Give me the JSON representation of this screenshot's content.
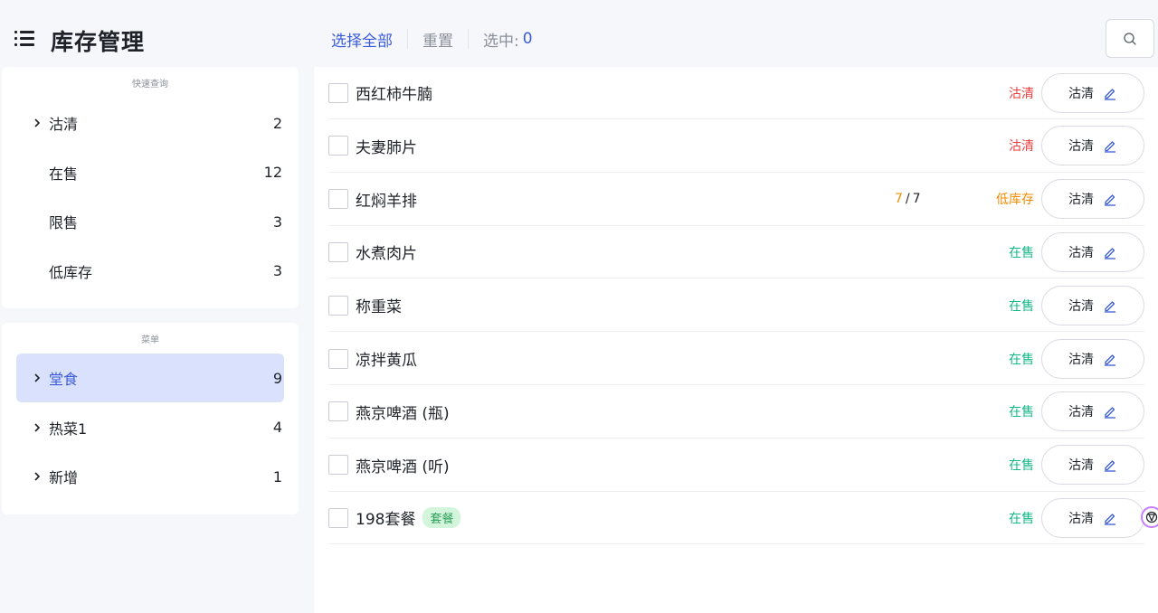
{
  "header": {
    "title": "库存管理",
    "select_all": "选择全部",
    "reset": "重置",
    "selected_label": "选中:",
    "selected_count": "0"
  },
  "sidebar": {
    "quick_title": "快速查询",
    "quick_items": [
      {
        "label": "沽清",
        "count": "2",
        "expandable": true
      },
      {
        "label": "在售",
        "count": "12",
        "expandable": false
      },
      {
        "label": "限售",
        "count": "3",
        "expandable": false
      },
      {
        "label": "低库存",
        "count": "3",
        "expandable": false
      }
    ],
    "menu_title": "菜单",
    "menu_items": [
      {
        "label": "堂食",
        "count": "9",
        "expandable": true,
        "active": true
      },
      {
        "label": "热菜1",
        "count": "4",
        "expandable": true
      },
      {
        "label": "新增",
        "count": "1",
        "expandable": true
      }
    ]
  },
  "items": [
    {
      "name": "西红柿牛腩",
      "status": "沽清",
      "status_color": "#f03e3e",
      "action": "沽清"
    },
    {
      "name": "夫妻肺片",
      "status": "沽清",
      "status_color": "#f03e3e",
      "action": "沽清"
    },
    {
      "name": "红焖羊排",
      "qty_available": "7",
      "qty_sep": "/",
      "qty_total": "7",
      "status": "低库存",
      "status_color": "#f08c00",
      "action": "沽清"
    },
    {
      "name": "水煮肉片",
      "status": "在售",
      "status_color": "#12b886",
      "action": "沽清"
    },
    {
      "name": "称重菜",
      "status": "在售",
      "status_color": "#12b886",
      "action": "沽清"
    },
    {
      "name": "凉拌黄瓜",
      "status": "在售",
      "status_color": "#12b886",
      "action": "沽清"
    },
    {
      "name": "燕京啤酒 (瓶)",
      "status": "在售",
      "status_color": "#12b886",
      "action": "沽清"
    },
    {
      "name": "燕京啤酒 (听)",
      "status": "在售",
      "status_color": "#12b886",
      "action": "沽清"
    },
    {
      "name": "198套餐",
      "tag": "套餐",
      "status": "在售",
      "status_color": "#12b886",
      "action": "沽清"
    }
  ],
  "colors": {
    "accent": "#3b5bdb",
    "active_bg": "#d9e1fc"
  },
  "icons": {
    "menu": "list-icon",
    "search": "search-icon",
    "edit": "pencil-icon",
    "expand": "chevron-right-icon"
  }
}
